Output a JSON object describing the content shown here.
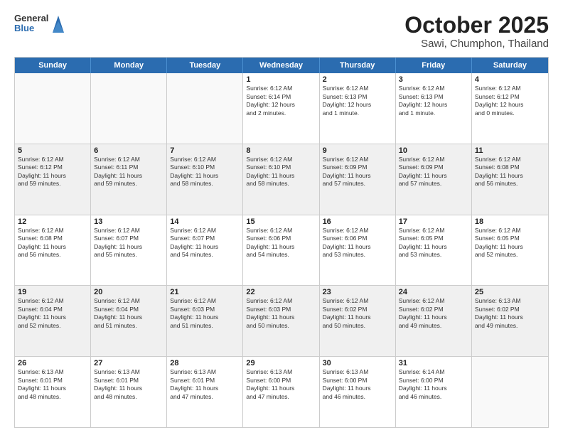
{
  "header": {
    "logo": {
      "general": "General",
      "blue": "Blue"
    },
    "title": "October 2025",
    "subtitle": "Sawi, Chumphon, Thailand"
  },
  "calendar": {
    "days_of_week": [
      "Sunday",
      "Monday",
      "Tuesday",
      "Wednesday",
      "Thursday",
      "Friday",
      "Saturday"
    ],
    "rows": [
      {
        "shaded": false,
        "cells": [
          {
            "day": "",
            "empty": true,
            "info": ""
          },
          {
            "day": "",
            "empty": true,
            "info": ""
          },
          {
            "day": "",
            "empty": true,
            "info": ""
          },
          {
            "day": "1",
            "empty": false,
            "info": "Sunrise: 6:12 AM\nSunset: 6:14 PM\nDaylight: 12 hours\nand 2 minutes."
          },
          {
            "day": "2",
            "empty": false,
            "info": "Sunrise: 6:12 AM\nSunset: 6:13 PM\nDaylight: 12 hours\nand 1 minute."
          },
          {
            "day": "3",
            "empty": false,
            "info": "Sunrise: 6:12 AM\nSunset: 6:13 PM\nDaylight: 12 hours\nand 1 minute."
          },
          {
            "day": "4",
            "empty": false,
            "info": "Sunrise: 6:12 AM\nSunset: 6:12 PM\nDaylight: 12 hours\nand 0 minutes."
          }
        ]
      },
      {
        "shaded": true,
        "cells": [
          {
            "day": "5",
            "empty": false,
            "info": "Sunrise: 6:12 AM\nSunset: 6:12 PM\nDaylight: 11 hours\nand 59 minutes."
          },
          {
            "day": "6",
            "empty": false,
            "info": "Sunrise: 6:12 AM\nSunset: 6:11 PM\nDaylight: 11 hours\nand 59 minutes."
          },
          {
            "day": "7",
            "empty": false,
            "info": "Sunrise: 6:12 AM\nSunset: 6:10 PM\nDaylight: 11 hours\nand 58 minutes."
          },
          {
            "day": "8",
            "empty": false,
            "info": "Sunrise: 6:12 AM\nSunset: 6:10 PM\nDaylight: 11 hours\nand 58 minutes."
          },
          {
            "day": "9",
            "empty": false,
            "info": "Sunrise: 6:12 AM\nSunset: 6:09 PM\nDaylight: 11 hours\nand 57 minutes."
          },
          {
            "day": "10",
            "empty": false,
            "info": "Sunrise: 6:12 AM\nSunset: 6:09 PM\nDaylight: 11 hours\nand 57 minutes."
          },
          {
            "day": "11",
            "empty": false,
            "info": "Sunrise: 6:12 AM\nSunset: 6:08 PM\nDaylight: 11 hours\nand 56 minutes."
          }
        ]
      },
      {
        "shaded": false,
        "cells": [
          {
            "day": "12",
            "empty": false,
            "info": "Sunrise: 6:12 AM\nSunset: 6:08 PM\nDaylight: 11 hours\nand 56 minutes."
          },
          {
            "day": "13",
            "empty": false,
            "info": "Sunrise: 6:12 AM\nSunset: 6:07 PM\nDaylight: 11 hours\nand 55 minutes."
          },
          {
            "day": "14",
            "empty": false,
            "info": "Sunrise: 6:12 AM\nSunset: 6:07 PM\nDaylight: 11 hours\nand 54 minutes."
          },
          {
            "day": "15",
            "empty": false,
            "info": "Sunrise: 6:12 AM\nSunset: 6:06 PM\nDaylight: 11 hours\nand 54 minutes."
          },
          {
            "day": "16",
            "empty": false,
            "info": "Sunrise: 6:12 AM\nSunset: 6:06 PM\nDaylight: 11 hours\nand 53 minutes."
          },
          {
            "day": "17",
            "empty": false,
            "info": "Sunrise: 6:12 AM\nSunset: 6:05 PM\nDaylight: 11 hours\nand 53 minutes."
          },
          {
            "day": "18",
            "empty": false,
            "info": "Sunrise: 6:12 AM\nSunset: 6:05 PM\nDaylight: 11 hours\nand 52 minutes."
          }
        ]
      },
      {
        "shaded": true,
        "cells": [
          {
            "day": "19",
            "empty": false,
            "info": "Sunrise: 6:12 AM\nSunset: 6:04 PM\nDaylight: 11 hours\nand 52 minutes."
          },
          {
            "day": "20",
            "empty": false,
            "info": "Sunrise: 6:12 AM\nSunset: 6:04 PM\nDaylight: 11 hours\nand 51 minutes."
          },
          {
            "day": "21",
            "empty": false,
            "info": "Sunrise: 6:12 AM\nSunset: 6:03 PM\nDaylight: 11 hours\nand 51 minutes."
          },
          {
            "day": "22",
            "empty": false,
            "info": "Sunrise: 6:12 AM\nSunset: 6:03 PM\nDaylight: 11 hours\nand 50 minutes."
          },
          {
            "day": "23",
            "empty": false,
            "info": "Sunrise: 6:12 AM\nSunset: 6:02 PM\nDaylight: 11 hours\nand 50 minutes."
          },
          {
            "day": "24",
            "empty": false,
            "info": "Sunrise: 6:12 AM\nSunset: 6:02 PM\nDaylight: 11 hours\nand 49 minutes."
          },
          {
            "day": "25",
            "empty": false,
            "info": "Sunrise: 6:13 AM\nSunset: 6:02 PM\nDaylight: 11 hours\nand 49 minutes."
          }
        ]
      },
      {
        "shaded": false,
        "cells": [
          {
            "day": "26",
            "empty": false,
            "info": "Sunrise: 6:13 AM\nSunset: 6:01 PM\nDaylight: 11 hours\nand 48 minutes."
          },
          {
            "day": "27",
            "empty": false,
            "info": "Sunrise: 6:13 AM\nSunset: 6:01 PM\nDaylight: 11 hours\nand 48 minutes."
          },
          {
            "day": "28",
            "empty": false,
            "info": "Sunrise: 6:13 AM\nSunset: 6:01 PM\nDaylight: 11 hours\nand 47 minutes."
          },
          {
            "day": "29",
            "empty": false,
            "info": "Sunrise: 6:13 AM\nSunset: 6:00 PM\nDaylight: 11 hours\nand 47 minutes."
          },
          {
            "day": "30",
            "empty": false,
            "info": "Sunrise: 6:13 AM\nSunset: 6:00 PM\nDaylight: 11 hours\nand 46 minutes."
          },
          {
            "day": "31",
            "empty": false,
            "info": "Sunrise: 6:14 AM\nSunset: 6:00 PM\nDaylight: 11 hours\nand 46 minutes."
          },
          {
            "day": "",
            "empty": true,
            "info": ""
          }
        ]
      }
    ]
  }
}
